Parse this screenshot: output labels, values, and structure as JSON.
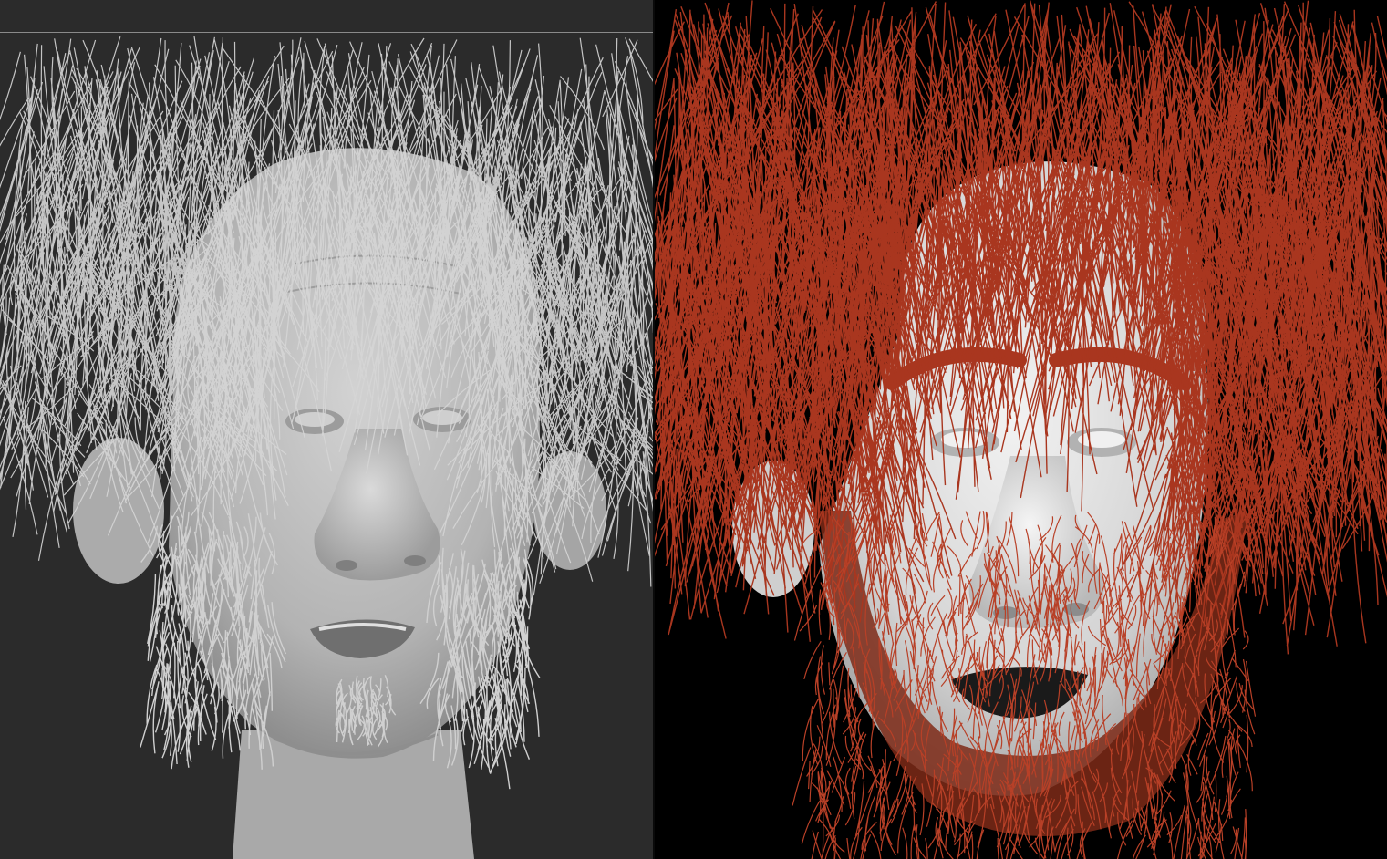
{
  "viewports": [
    {
      "id": "clay-viewport",
      "render_mode": "clay-preview",
      "background_color": "#2b2b2b",
      "hair_color": "#d6d6d6",
      "skin_color": "#bdbdbd",
      "icon": "sculpt-head-icon"
    },
    {
      "id": "render-viewport",
      "render_mode": "final-render",
      "background_color": "#000000",
      "hair_color": "#a9361f",
      "skin_color": "#dcdcdc",
      "icon": "rendered-head-icon"
    }
  ]
}
